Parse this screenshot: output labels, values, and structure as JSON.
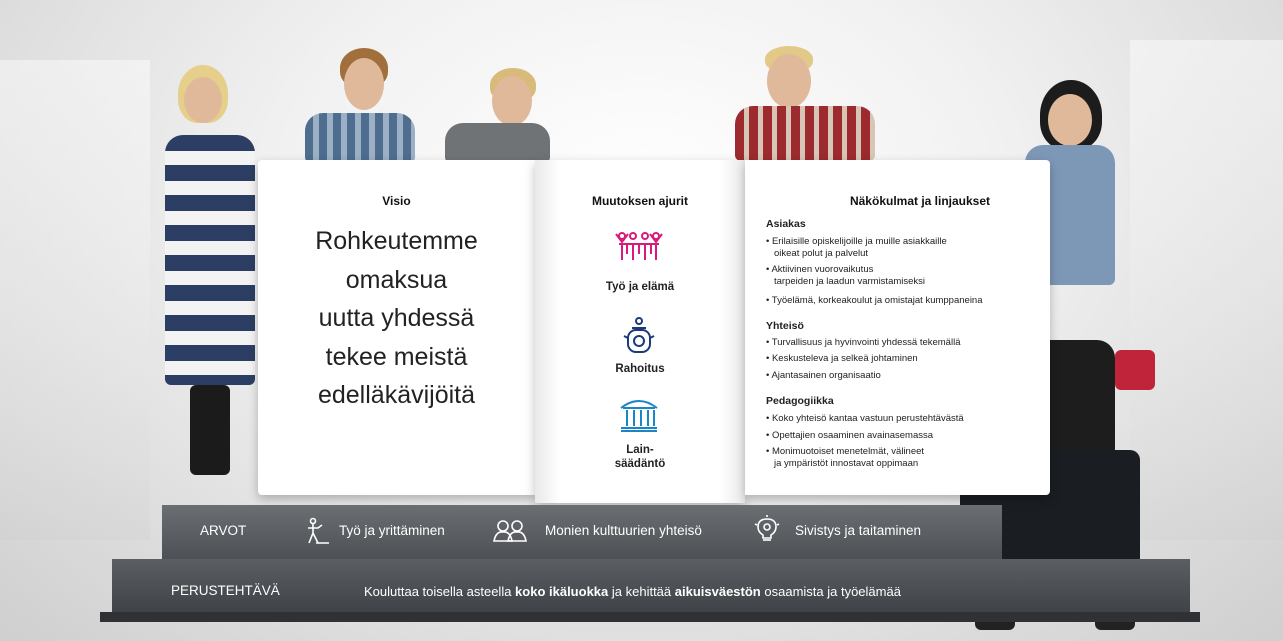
{
  "visio": {
    "heading": "Visio",
    "lines": [
      "Rohkeutemme",
      "omaksua",
      "uutta yhdessä",
      "tekee meistä",
      "edelläkävijöitä"
    ]
  },
  "ajurit": {
    "heading": "Muutoksen ajurit",
    "items": [
      {
        "label": "Työ ja elämä",
        "icon": "people-icon",
        "color": "#d81b7a"
      },
      {
        "label": "Rahoitus",
        "icon": "piggy-bank-icon",
        "color": "#1a3a7a"
      },
      {
        "label_line1": "Lain-",
        "label_line2": "säädäntö",
        "icon": "institution-icon",
        "color": "#1a86c8"
      }
    ]
  },
  "linjaukset": {
    "heading": "Näkökulmat ja linjaukset",
    "sections": [
      {
        "title": "Asiakas",
        "items": [
          [
            "• Erilaisille opiskelijoille ja muille asiakkaille",
            "oikeat polut ja palvelut"
          ],
          [
            "• Aktiivinen vuorovaikutus",
            "tarpeiden ja laadun varmistamiseksi"
          ],
          [
            "• Työelämä, korkeakoulut ja omistajat kumppaneina"
          ]
        ]
      },
      {
        "title": "Yhteisö",
        "items": [
          [
            "• Turvallisuus ja hyvinvointi yhdessä tekemällä"
          ],
          [
            "• Keskusteleva ja selkeä johtaminen"
          ],
          [
            "• Ajantasainen organisaatio"
          ]
        ]
      },
      {
        "title": "Pedagogiikka",
        "items": [
          [
            "• Koko yhteisö kantaa vastuun perustehtävästä"
          ],
          [
            "• Opettajien osaaminen avainasemassa"
          ],
          [
            "• Monimuotoiset menetelmät, välineet",
            "ja ympäristöt innostavat oppimaan"
          ]
        ]
      }
    ]
  },
  "arvot": {
    "label": "ARVOT",
    "items": [
      {
        "label": "Työ ja yrittäminen",
        "icon": "worker-icon"
      },
      {
        "label": "Monien kulttuurien yhteisö",
        "icon": "group-icon"
      },
      {
        "label": "Sivistys ja taitaminen",
        "icon": "lightbulb-icon"
      }
    ]
  },
  "perustehtava": {
    "label": "PERUSTEHTÄVÄ",
    "text_1": "Kouluttaa toisella asteella ",
    "bold_1": "koko ikäluokka",
    "text_2": " ja kehittää ",
    "bold_2": "aikuisväestön",
    "text_3": " osaamista ja työelämää"
  },
  "colors": {
    "step_dark": "#4d5054",
    "magenta": "#d81b7a",
    "navy": "#1a3a7a",
    "blue": "#1a86c8"
  }
}
